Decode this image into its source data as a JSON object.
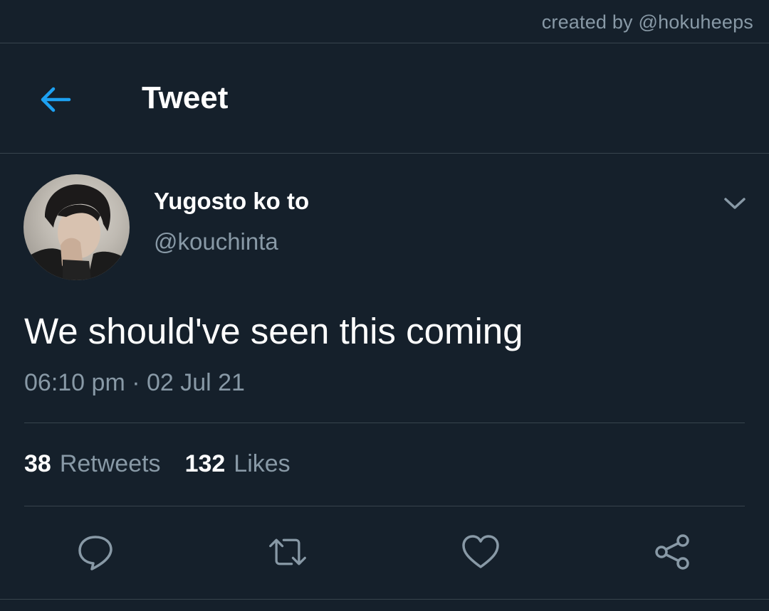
{
  "watermark": "created by @hokuheeps",
  "header": {
    "title": "Tweet",
    "back_icon": "arrow-left-icon",
    "accent_color": "#1da1f2"
  },
  "tweet": {
    "display_name": "Yugosto ko to",
    "handle": "@kouchinta",
    "text": "We should've seen this coming",
    "timestamp": "06:10 pm · 02 Jul 21",
    "more_icon": "chevron-down-icon"
  },
  "stats": {
    "retweets_count": "38",
    "retweets_label": "Retweets",
    "likes_count": "132",
    "likes_label": "Likes"
  },
  "actions": [
    {
      "name": "reply",
      "icon": "reply-icon"
    },
    {
      "name": "retweet",
      "icon": "retweet-icon"
    },
    {
      "name": "like",
      "icon": "heart-icon"
    },
    {
      "name": "share",
      "icon": "share-icon"
    }
  ],
  "colors": {
    "background": "#15202b",
    "secondary_text": "#8899a6",
    "divider": "#38444d"
  }
}
